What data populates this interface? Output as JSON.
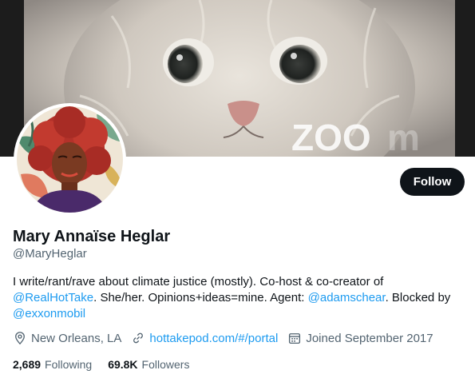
{
  "banner": {
    "watermark_text": "ZOO",
    "colors": {
      "background": "#1c1c1c",
      "fur": "#d9d4cd"
    }
  },
  "profile": {
    "display_name": "Mary Annaïse Heglar",
    "handle": "@MaryHeglar",
    "follow_label": "Follow",
    "bio": {
      "line1": "I write/rant/rave about climate justice (mostly). Co-host & co-creator of",
      "mention_realhottake": "@RealHotTake",
      "line2_rest": ". She/her. Opinions+ideas=mine. Agent: ",
      "mention_adamschear": "@adamschear",
      "line2_end": ". Blocked by",
      "mention_exxonmobil": "@exxonmobil"
    },
    "meta": {
      "location": "New Orleans, LA",
      "website": "hottakepod.com/#/portal",
      "joined": "Joined September 2017",
      "icons": [
        "location-icon",
        "link-icon",
        "calendar-icon"
      ]
    },
    "stats": {
      "following_count": "2,689",
      "following_label": "Following",
      "followers_count": "69.8K",
      "followers_label": "Followers"
    }
  },
  "colors": {
    "link": "#1d9bf0",
    "text_primary": "#0f1419",
    "text_secondary": "#536471",
    "button_bg": "#0f1419"
  }
}
